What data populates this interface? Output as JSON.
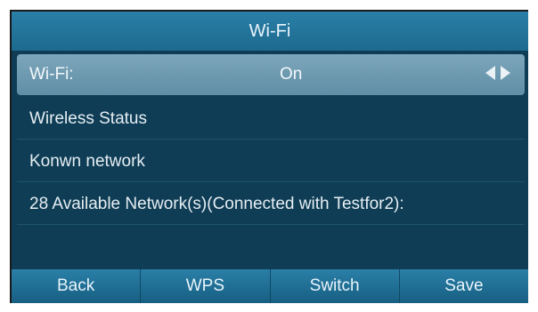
{
  "title": "Wi-Fi",
  "wifi_row": {
    "label": "Wi-Fi:",
    "value": "On"
  },
  "menu": [
    {
      "label": "Wireless Status"
    },
    {
      "label": "Konwn network"
    },
    {
      "label": "28 Available Network(s)(Connected with Testfor2):"
    }
  ],
  "softkeys": [
    "Back",
    "WPS",
    "Switch",
    "Save"
  ],
  "icons": {
    "prev": "triangle-left-icon",
    "next": "triangle-right-icon"
  },
  "colors": {
    "screen_bg": "#0e3d55",
    "title_bar": "#2a7fa7",
    "selected_row": "#7da6bb"
  }
}
